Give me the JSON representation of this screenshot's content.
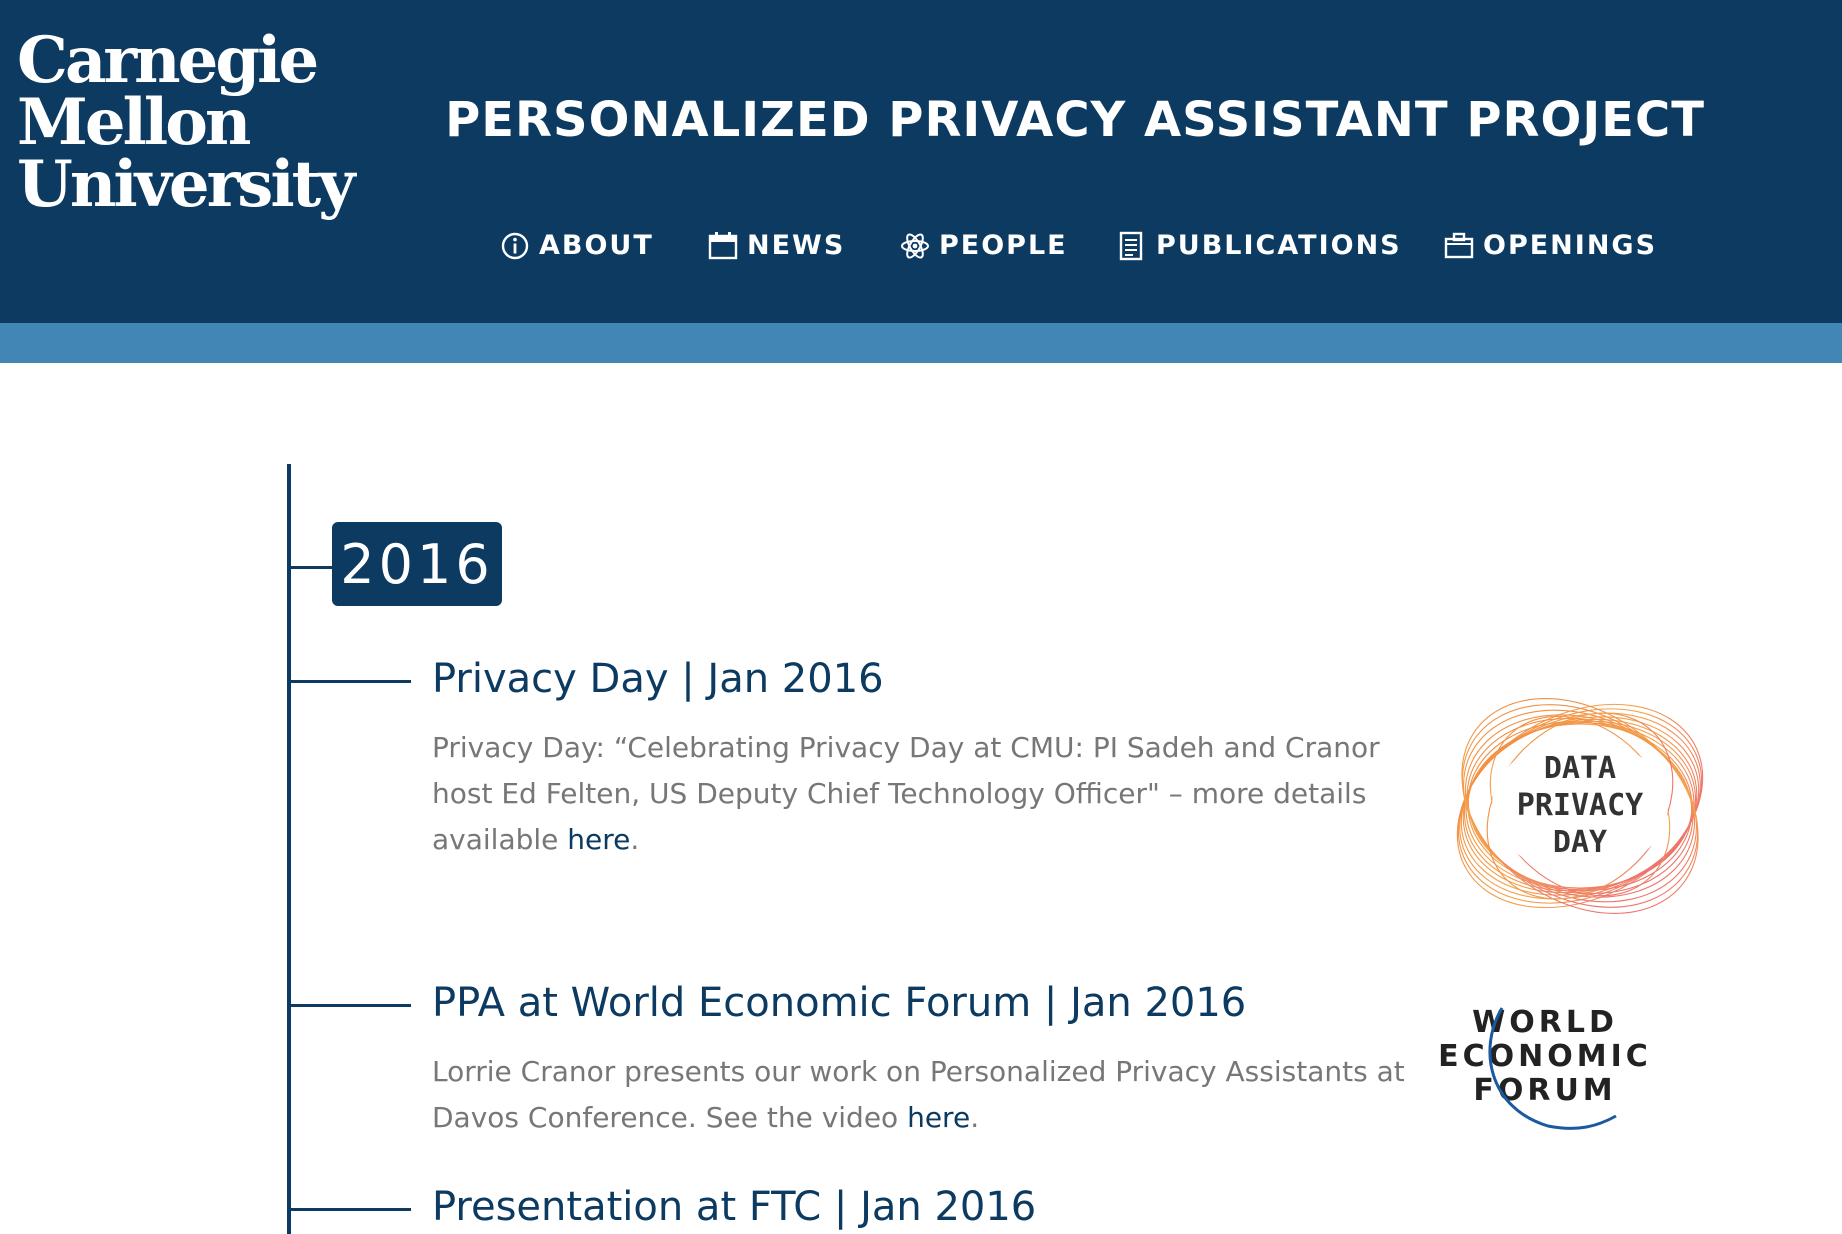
{
  "header": {
    "logo_lines": [
      "Carnegie",
      "Mellon",
      "University"
    ],
    "site_title": "PERSONALIZED PRIVACY ASSISTANT PROJECT",
    "nav": [
      {
        "label": "ABOUT",
        "icon": "info-icon"
      },
      {
        "label": "NEWS",
        "icon": "calendar-icon"
      },
      {
        "label": "PEOPLE",
        "icon": "atom-icon"
      },
      {
        "label": "PUBLICATIONS",
        "icon": "document-icon"
      },
      {
        "label": "OPENINGS",
        "icon": "briefcase-icon"
      }
    ]
  },
  "timeline": {
    "year": "2016",
    "items": [
      {
        "title": "Privacy Day | Jan 2016",
        "desc_before": "Privacy Day: “Celebrating Privacy Day at CMU: PI Sadeh and Cranor host Ed Felten, US Deputy Chief Technology Officer\" – more details available ",
        "link": "here",
        "desc_after": ".",
        "image_text": [
          "DATA",
          "PRIVACY",
          "DAY"
        ]
      },
      {
        "title": "PPA at World Economic Forum | Jan 2016",
        "desc_before": "Lorrie Cranor presents our work on Personalized Privacy Assistants at Davos Conference. See the video ",
        "link": "here",
        "desc_after": ".",
        "image_text": [
          "WORLD",
          "ECONOMIC",
          "FORUM"
        ]
      },
      {
        "title": "Presentation at FTC | Jan 2016"
      }
    ]
  },
  "colors": {
    "header_bg": "#0c3a61",
    "stripe": "#4186b4",
    "link": "#0c3a61",
    "body_text": "#777777",
    "dpd_orange": "#f07a2a",
    "dpd_pink": "#e8506a"
  }
}
